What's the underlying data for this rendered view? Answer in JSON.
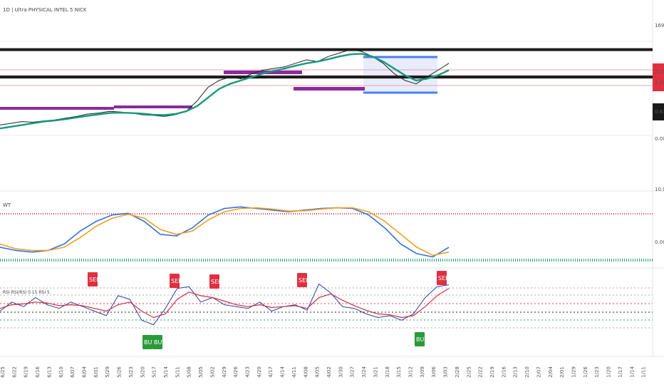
{
  "chart": {
    "title": "1D | Ultra PHYSICAL INTEL 5 NICK",
    "price_labels": [
      {
        "text": "1697",
        "color": "#1a1a1a"
      },
      {
        "text": "0.7500",
        "color": "#e03040"
      },
      {
        "text": "1.2000",
        "color": "#e03040"
      },
      {
        "text": "0.6343",
        "color": "#1a1a1a"
      },
      {
        "text": "0.000",
        "color": "#ffffff"
      }
    ],
    "oscillator_labels": [
      "10.000",
      "0.000"
    ],
    "rsi_title": "RSI RSI/RSI 0.15 RSI 5",
    "oscillator_title": "WT"
  },
  "chart_data": [
    {
      "type": "line",
      "pane": "price",
      "series": [
        {
          "name": "",
          "color": "#222222",
          "values": [
            1.2,
            1.25,
            1.3,
            1.28,
            1.32,
            1.35,
            1.4,
            1.45,
            1.52,
            1.55,
            1.6,
            1.58,
            1.55,
            1.5,
            1.48,
            1.45,
            1.5,
            1.6,
            1.9,
            2.3,
            2.5,
            2.6,
            2.55,
            2.7,
            2.8,
            2.85,
            2.9,
            3.0,
            3.1,
            3.05,
            3.2,
            3.3,
            3.4,
            3.35,
            3.2,
            3.0,
            2.7,
            2.5,
            2.4,
            2.6,
            2.8,
            3.0
          ]
        },
        {
          "name": "",
          "color": "#159a80",
          "values": [
            1.1,
            1.15,
            1.2,
            1.25,
            1.3,
            1.33,
            1.37,
            1.42,
            1.47,
            1.51,
            1.55,
            1.56,
            1.55,
            1.53,
            1.5,
            1.49,
            1.52,
            1.6,
            1.75,
            2.0,
            2.25,
            2.4,
            2.5,
            2.6,
            2.7,
            2.78,
            2.85,
            2.93,
            3.0,
            3.05,
            3.12,
            3.2,
            3.26,
            3.28,
            3.2,
            3.05,
            2.85,
            2.65,
            2.5,
            2.55,
            2.65,
            2.8
          ]
        }
      ],
      "levels": [
        3.4,
        2.6
      ],
      "level_color": "#1a1a1a"
    },
    {
      "type": "line",
      "pane": "oscillator",
      "series": [
        {
          "name": "",
          "color": "#3070e0",
          "values": [
            -0.2,
            -0.3,
            -0.35,
            -0.3,
            -0.1,
            0.3,
            0.6,
            0.8,
            0.85,
            0.6,
            0.2,
            0.15,
            0.4,
            0.8,
            1.0,
            1.05,
            1.0,
            0.95,
            0.9,
            0.95,
            1.0,
            1.02,
            1.0,
            0.8,
            0.4,
            -0.1,
            -0.4,
            -0.5,
            -0.2
          ]
        },
        {
          "name": "",
          "color": "#f0a020",
          "values": [
            -0.1,
            -0.25,
            -0.3,
            -0.3,
            -0.2,
            0.1,
            0.45,
            0.7,
            0.82,
            0.7,
            0.35,
            0.2,
            0.3,
            0.65,
            0.9,
            1.0,
            1.02,
            0.98,
            0.92,
            0.93,
            0.98,
            1.02,
            1.02,
            0.9,
            0.6,
            0.2,
            -0.2,
            -0.45,
            -0.35
          ]
        }
      ]
    },
    {
      "type": "line",
      "pane": "rsi",
      "series": [
        {
          "name": "",
          "color": "#2a40a0",
          "values": [
            45,
            55,
            50,
            60,
            52,
            48,
            55,
            50,
            45,
            40,
            62,
            58,
            35,
            30,
            48,
            70,
            72,
            55,
            60,
            52,
            50,
            48,
            55,
            45,
            50,
            52,
            46,
            75,
            65,
            50,
            48,
            42,
            38,
            40,
            35,
            42,
            60,
            72,
            74
          ]
        },
        {
          "name": "",
          "color": "#d03040",
          "values": [
            48,
            52,
            53,
            55,
            54,
            51,
            52,
            51,
            48,
            45,
            52,
            55,
            45,
            38,
            42,
            58,
            66,
            62,
            60,
            56,
            52,
            50,
            52,
            49,
            50,
            51,
            48,
            60,
            64,
            57,
            51,
            46,
            42,
            41,
            38,
            40,
            50,
            62,
            70
          ]
        }
      ]
    }
  ],
  "x_tick_labels": [
    "6/25",
    "6/22",
    "6/19",
    "6/16",
    "6/13",
    "6/10",
    "6/07",
    "6/04",
    "6/01",
    "5/29",
    "5/26",
    "5/23",
    "5/20",
    "5/17",
    "5/14",
    "5/11",
    "5/08",
    "5/05",
    "5/02",
    "4/29",
    "4/26",
    "4/23",
    "4/20",
    "4/17",
    "4/14",
    "4/11",
    "4/08",
    "4/05",
    "4/02",
    "3/30",
    "3/27",
    "3/24",
    "3/21",
    "3/18",
    "3/15",
    "3/12",
    "3/09",
    "3/06",
    "3/03",
    "2/28",
    "2/25",
    "2/22",
    "2/19",
    "2/16",
    "2/13",
    "2/10",
    "2/07",
    "2/04",
    "2/01",
    "1/29",
    "1/26",
    "1/23",
    "1/20",
    "1/17",
    "1/14",
    "1/11"
  ],
  "badges": [
    {
      "text": "SELL",
      "color": "#e03040"
    },
    {
      "text": "SELL",
      "color": "#e03040"
    },
    {
      "text": "SELL",
      "color": "#e03040"
    },
    {
      "text": "SELL",
      "color": "#e03040"
    },
    {
      "text": "SELL",
      "color": "#e03040"
    },
    {
      "text": "BUY",
      "color": "#2a9a3a"
    },
    {
      "text": "BUY",
      "color": "#2a9a3a"
    },
    {
      "text": "BUY",
      "color": "#2a9a3a"
    }
  ]
}
